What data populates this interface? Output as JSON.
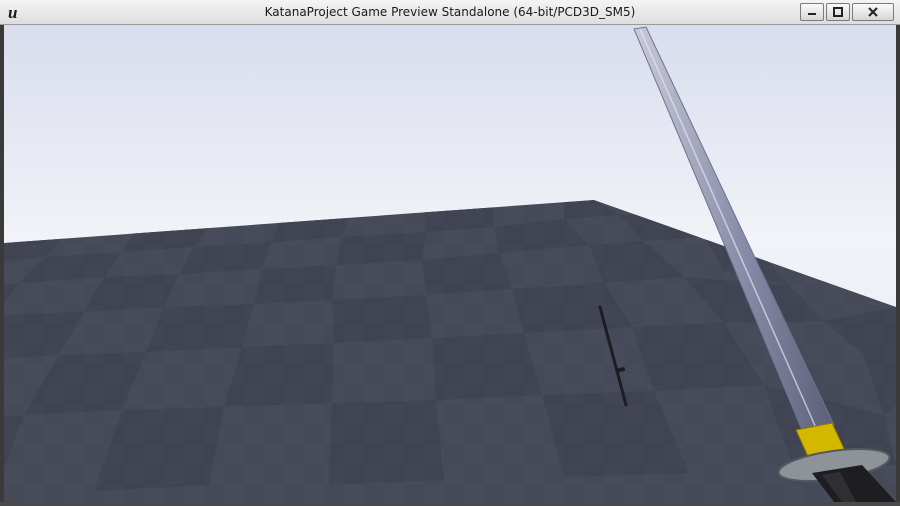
{
  "window": {
    "title": "KatanaProject Game Preview Standalone (64-bit/PCD3D_SM5)",
    "logo": "unreal-engine-logo",
    "controls": [
      "minimize-icon",
      "maximize-icon",
      "close-icon"
    ]
  },
  "scene": {
    "sky_color": "#e9ecf4",
    "floor_dark": "#3f4352",
    "floor_light": "#5a5e6b",
    "blade_color": "#8d90ad",
    "guard_color": "#8b8f96",
    "collar_color": "#d4b800",
    "handle_color": "#1e1e22"
  }
}
